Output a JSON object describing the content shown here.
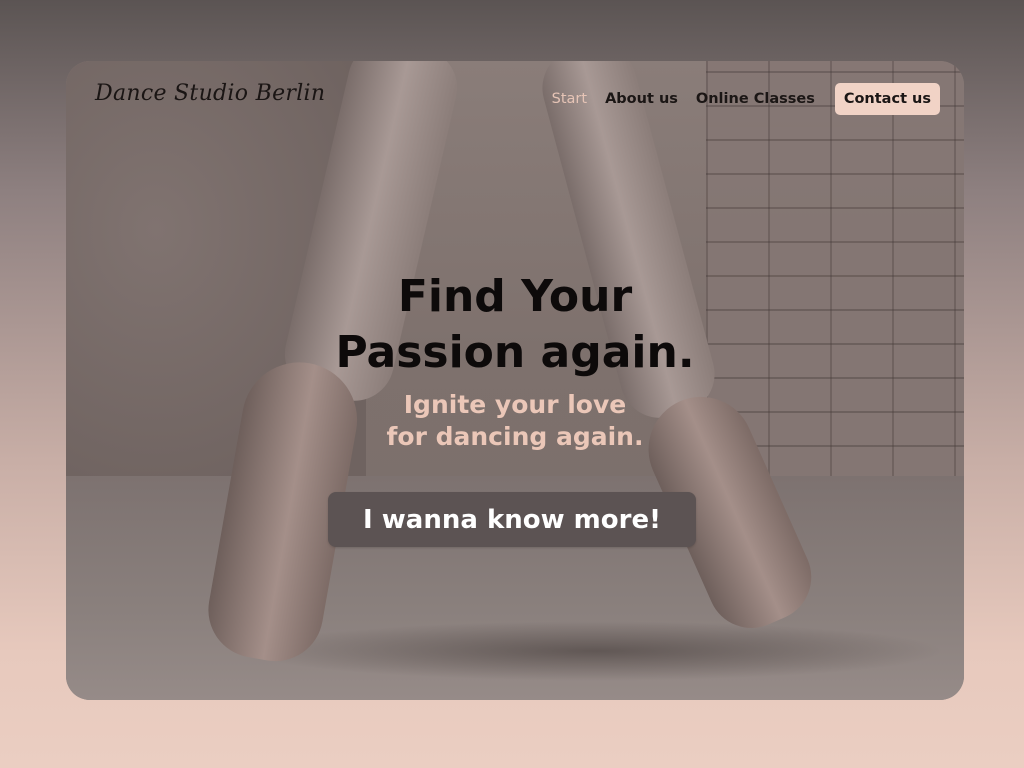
{
  "brand": {
    "logo_text": "Dance Studio Berlin"
  },
  "nav": {
    "items": [
      {
        "label": "Start",
        "active": true
      },
      {
        "label": "About us"
      },
      {
        "label": "Online Classes"
      }
    ],
    "contact_label": "Contact us"
  },
  "hero": {
    "title_line1": "Find Your",
    "title_line2": "Passion again.",
    "subtitle_line1": "Ignite your love",
    "subtitle_line2": "for dancing again.",
    "cta_label": "I wanna know more!"
  },
  "colors": {
    "accent": "#f1d3c6",
    "button": "#5c5353",
    "active_nav": "#e6c4b6"
  }
}
